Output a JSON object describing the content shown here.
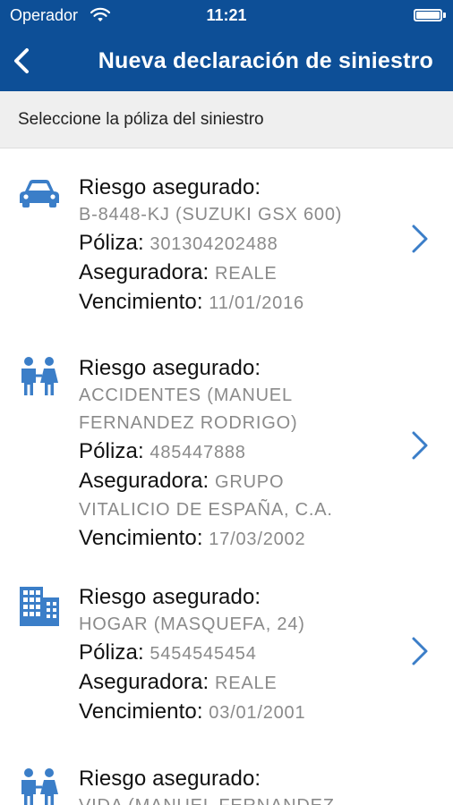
{
  "status_bar": {
    "carrier": "Operador",
    "time": "11:21",
    "battery_level": 1.0
  },
  "navbar": {
    "back_icon": "chevron-left-icon",
    "title": "Nueva declaración de siniestro"
  },
  "subheader": {
    "text": "Seleccione la póliza del siniestro"
  },
  "labels": {
    "riesgo": "Riesgo asegurado:",
    "poliza": "Póliza:",
    "aseguradora": "Aseguradora:",
    "vencimiento": "Vencimiento:"
  },
  "colors": {
    "brand": "#0d4f97",
    "icon": "#3b7ec8",
    "chevron": "#3b7ec8",
    "value_text": "#8a8a8a"
  },
  "policies": [
    {
      "icon": "car-icon",
      "riesgo_line1": "B-8448-KJ (SUZUKI GSX 600)",
      "poliza": "301304202488",
      "aseguradora_line1": "REALE",
      "vencimiento": "11/01/2016"
    },
    {
      "icon": "people-icon",
      "riesgo_line1": "ACCIDENTES (MANUEL",
      "riesgo_line2": "FERNANDEZ RODRIGO)",
      "poliza": "485447888",
      "aseguradora_line1": "GRUPO",
      "aseguradora_line2": "VITALICIO DE ESPAÑA, C.A.",
      "vencimiento": "17/03/2002"
    },
    {
      "icon": "building-icon",
      "riesgo_line1": "HOGAR (MASQUEFA, 24)",
      "poliza": "5454545454",
      "aseguradora_line1": "REALE",
      "vencimiento": "03/01/2001"
    },
    {
      "icon": "people-icon",
      "riesgo_line1": "VIDA (MANUEL FERNANDEZ"
    }
  ]
}
